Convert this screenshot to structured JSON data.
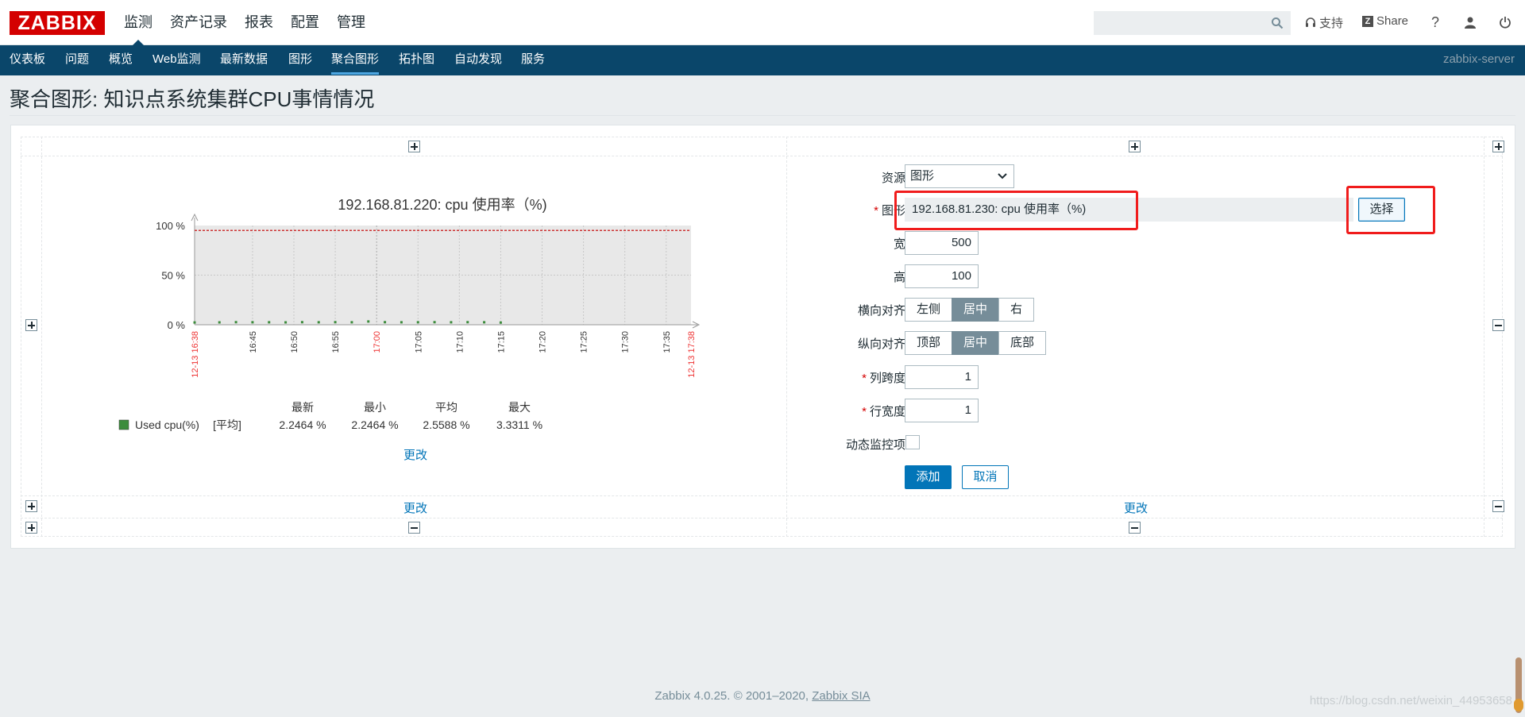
{
  "header": {
    "logo": "ZABBIX",
    "menu": [
      "监测",
      "资产记录",
      "报表",
      "配置",
      "管理"
    ],
    "active_menu": 0,
    "search_placeholder": "",
    "support_label": "支持",
    "share_label": "Share",
    "help_label": "?"
  },
  "subnav": {
    "items": [
      "仪表板",
      "问题",
      "概览",
      "Web监测",
      "最新数据",
      "图形",
      "聚合图形",
      "拓扑图",
      "自动发现",
      "服务"
    ],
    "active_index": 6,
    "server": "zabbix-server"
  },
  "page": {
    "title": "聚合图形: 知识点系统集群CPU事情情况"
  },
  "chart_data": {
    "type": "line",
    "title": "192.168.81.220: cpu 使用率（%)",
    "y_ticks": [
      "100 %",
      "50 %",
      "0 %"
    ],
    "ylim": [
      0,
      100
    ],
    "x_ticks": [
      "12-13 16:38",
      "16:45",
      "16:50",
      "16:55",
      "17:00",
      "17:05",
      "17:10",
      "17:15",
      "17:20",
      "17:25",
      "17:30",
      "17:35",
      "12-13 17:38"
    ],
    "x_tick_red": [
      true,
      false,
      false,
      false,
      true,
      false,
      false,
      false,
      false,
      false,
      false,
      false,
      true
    ],
    "x_minutes": [
      0,
      7,
      12,
      17,
      22,
      27,
      32,
      37,
      42,
      47,
      52,
      57,
      60
    ],
    "trigger_line_value": 95,
    "series": [
      {
        "name": "Used cpu(%)",
        "color": "#3c8c3c",
        "x_minutes": [
          0,
          3,
          5,
          7,
          9,
          11,
          13,
          15,
          17,
          19,
          21,
          23,
          25,
          27,
          29,
          31,
          33,
          35,
          37
        ],
        "values": [
          2.3,
          2.4,
          2.6,
          2.5,
          2.5,
          2.4,
          2.6,
          2.5,
          2.6,
          2.5,
          3.3,
          2.6,
          2.5,
          2.5,
          2.6,
          2.5,
          2.6,
          2.5,
          2.2
        ]
      }
    ],
    "legend": {
      "headers": [
        "最新",
        "最小",
        "平均",
        "最大"
      ],
      "func": "[平均]",
      "values": [
        "2.2464 %",
        "2.2464 %",
        "2.5588 %",
        "3.3311 %"
      ]
    }
  },
  "cell_links": {
    "graph_change": "更改",
    "left_change": "更改",
    "right_change": "更改"
  },
  "form": {
    "resource_label": "资源",
    "resource_value": "图形",
    "graph_label": "图形",
    "graph_value": "192.168.81.230: cpu 使用率（%)",
    "select_button": "选择",
    "width_label": "宽",
    "width_value": "500",
    "height_label": "高",
    "height_value": "100",
    "halign_label": "横向对齐",
    "halign_options": [
      "左侧",
      "居中",
      "右"
    ],
    "halign_selected": 1,
    "valign_label": "纵向对齐",
    "valign_options": [
      "顶部",
      "居中",
      "底部"
    ],
    "valign_selected": 1,
    "colspan_label": "列跨度",
    "colspan_value": "1",
    "rowspan_label": "行宽度",
    "rowspan_value": "1",
    "dynamic_label": "动态监控项",
    "dynamic_checked": false,
    "add_button": "添加",
    "cancel_button": "取消"
  },
  "footer": {
    "text": "Zabbix 4.0.25. © 2001–2020, ",
    "link": "Zabbix SIA"
  },
  "watermark": "https://blog.csdn.net/weixin_44953658"
}
